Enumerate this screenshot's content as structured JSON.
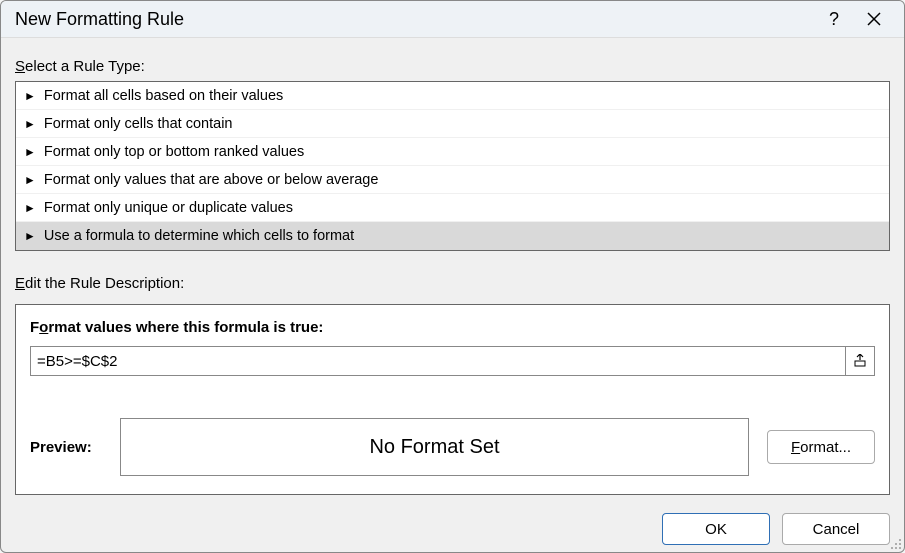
{
  "titlebar": {
    "title": "New Formatting Rule",
    "help": "?"
  },
  "section": {
    "select_rule_type_pre": "S",
    "select_rule_type_post": "elect a Rule Type:",
    "edit_desc_pre": "E",
    "edit_desc_post": "dit the Rule Description:"
  },
  "rules": [
    {
      "label": "Format all cells based on their values",
      "selected": false
    },
    {
      "label": "Format only cells that contain",
      "selected": false
    },
    {
      "label": "Format only top or bottom ranked values",
      "selected": false
    },
    {
      "label": "Format only values that are above or below average",
      "selected": false
    },
    {
      "label": "Format only unique or duplicate values",
      "selected": false
    },
    {
      "label": "Use a formula to determine which cells to format",
      "selected": true
    }
  ],
  "formula": {
    "label_pre": "F",
    "label_mid": "o",
    "label_post": "rmat values where this formula is true:",
    "value": "=B5>=$C$2"
  },
  "preview": {
    "label": "Preview:",
    "text": "No Format Set",
    "format_btn_pre": "F",
    "format_btn_post": "ormat..."
  },
  "buttons": {
    "ok": "OK",
    "cancel": "Cancel"
  }
}
